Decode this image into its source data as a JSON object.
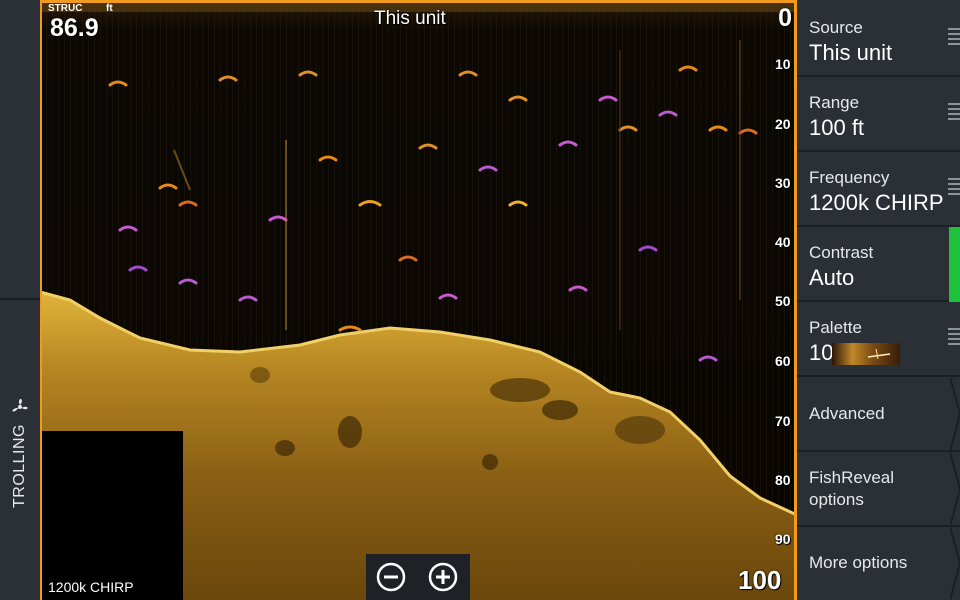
{
  "mode": {
    "label": "TROLLING",
    "icon": "propeller-icon"
  },
  "sonar": {
    "title": "This unit",
    "view_label": "STRUC",
    "unit": "ft",
    "temperature": "86.9",
    "depth_top": "0",
    "depth_bottom": "100",
    "depth_ticks": [
      "10",
      "20",
      "30",
      "40",
      "50",
      "60",
      "70",
      "80",
      "90"
    ],
    "frequency_label": "1200k CHIRP",
    "colors": {
      "frame": "#f29a1c",
      "bottom": "#c9931f"
    }
  },
  "zoom": {
    "out_icon": "zoom-out-icon",
    "in_icon": "zoom-in-icon"
  },
  "menu": {
    "source": {
      "label": "Source",
      "value": "This unit"
    },
    "range": {
      "label": "Range",
      "value": "100 ft"
    },
    "frequency": {
      "label": "Frequency",
      "value": "1200k CHIRP"
    },
    "contrast": {
      "label": "Contrast",
      "value": "Auto"
    },
    "palette": {
      "label": "Palette",
      "value": "10"
    },
    "advanced": {
      "label": "Advanced"
    },
    "fishreveal": {
      "label": "FishReveal\noptions"
    },
    "more": {
      "label": "More options"
    }
  }
}
